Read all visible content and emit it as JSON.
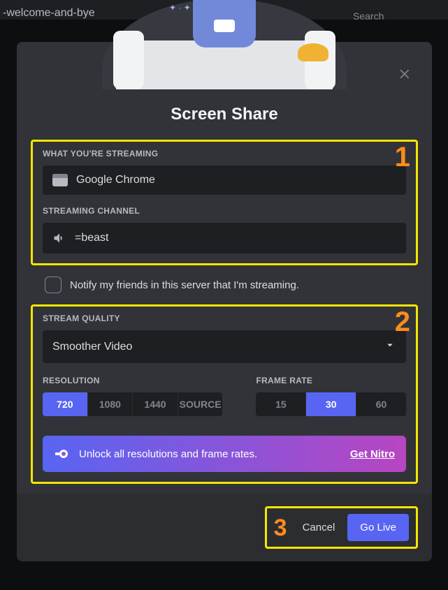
{
  "background": {
    "channel_name": "-welcome-and-bye",
    "search_placeholder": "Search"
  },
  "modal": {
    "title": "Screen Share",
    "section1": {
      "streaming_label": "WHAT YOU'RE STREAMING",
      "streaming_value": "Google Chrome",
      "channel_label": "STREAMING CHANNEL",
      "channel_value": "=beast"
    },
    "notify_label": "Notify my friends in this server that I'm streaming.",
    "quality": {
      "label": "STREAM QUALITY",
      "dropdown_value": "Smoother Video",
      "resolution_label": "RESOLUTION",
      "framerate_label": "FRAME RATE",
      "resolutions": [
        "720",
        "1080",
        "1440",
        "SOURCE"
      ],
      "resolution_active": "720",
      "framerates": [
        "15",
        "30",
        "60"
      ],
      "framerate_active": "30",
      "nitro_text": "Unlock all resolutions and frame rates.",
      "nitro_cta": "Get Nitro"
    },
    "footer": {
      "cancel": "Cancel",
      "go_live": "Go Live"
    },
    "annotations": {
      "n1": "1",
      "n2": "2",
      "n3": "3"
    }
  }
}
